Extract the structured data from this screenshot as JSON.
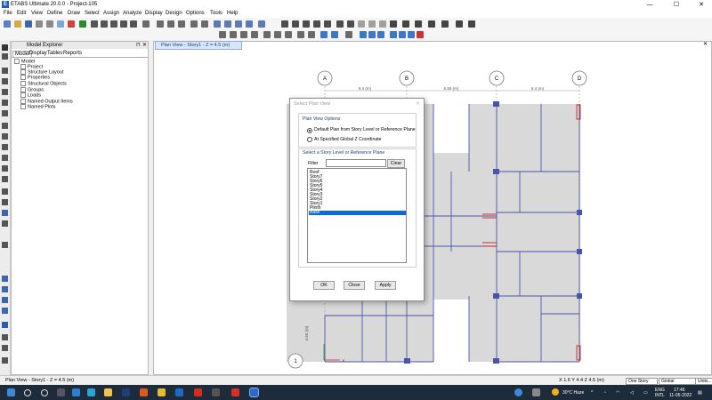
{
  "app": {
    "title": "ETABS Ultimate 20.0.0 - Project-105",
    "logo": "E"
  },
  "window_controls": {
    "minimize": "—",
    "maximize": "☐",
    "close": "✕"
  },
  "menu": [
    "File",
    "Edit",
    "View",
    "Define",
    "Draw",
    "Select",
    "Assign",
    "Analyze",
    "Display",
    "Design",
    "Options",
    "Tools",
    "Help"
  ],
  "explorer": {
    "title": "Model Explorer",
    "tabs": [
      "Model",
      "Display",
      "Tables",
      "Reports"
    ],
    "tree": [
      "Model",
      "Project",
      "Structure Layout",
      "Properties",
      "Structural Objects",
      "Groups",
      "Loads",
      "Named Output Items",
      "Named Plots"
    ]
  },
  "plan": {
    "tab_title": "Plan View - Story1 - Z = 4.5 (m)",
    "grid_labels": [
      "A",
      "B",
      "C",
      "D",
      "1"
    ],
    "dimensions": [
      "6.4 (m)",
      "6.55 (m)",
      "6.4 (m)",
      "4.65 (m)"
    ]
  },
  "dialog": {
    "title": "Select Plan View",
    "group1_title": "Plan View Options",
    "option1": "Default Plan from Story Level or Reference Plane",
    "option2": "At Specified Global Z Coordinate",
    "group2_title": "Select a Story Level or Reference Plane",
    "filter_label": "Filter",
    "filter_value": "",
    "clear_label": "Clear",
    "stories": [
      "Roof",
      "Story7",
      "Story6",
      "Story5",
      "Story4",
      "Story3",
      "Story2",
      "Story1",
      "Plinth",
      "Base"
    ],
    "selected_story": "Base",
    "ok_label": "OK",
    "close_label": "Close",
    "apply_label": "Apply"
  },
  "status": {
    "left": "Plan View - Story1 - Z = 4.5 (m)",
    "coords": "X 1.6  Y 4.4  Z 4.5 (m)",
    "story_mode": "One Story",
    "coord_sys": "Global",
    "units": "Units..."
  },
  "taskbar": {
    "weather": "30°C  Haze",
    "lang": "ENG\nINTL",
    "lang1": "ENG",
    "lang2": "INTL",
    "time": "17:46",
    "date": "11-05-2022"
  },
  "colors": {
    "grid": "#4b55a8",
    "accent": "#0b6ad6",
    "shell": "#d9d9d9",
    "taskbar": "#1e2b3a"
  }
}
